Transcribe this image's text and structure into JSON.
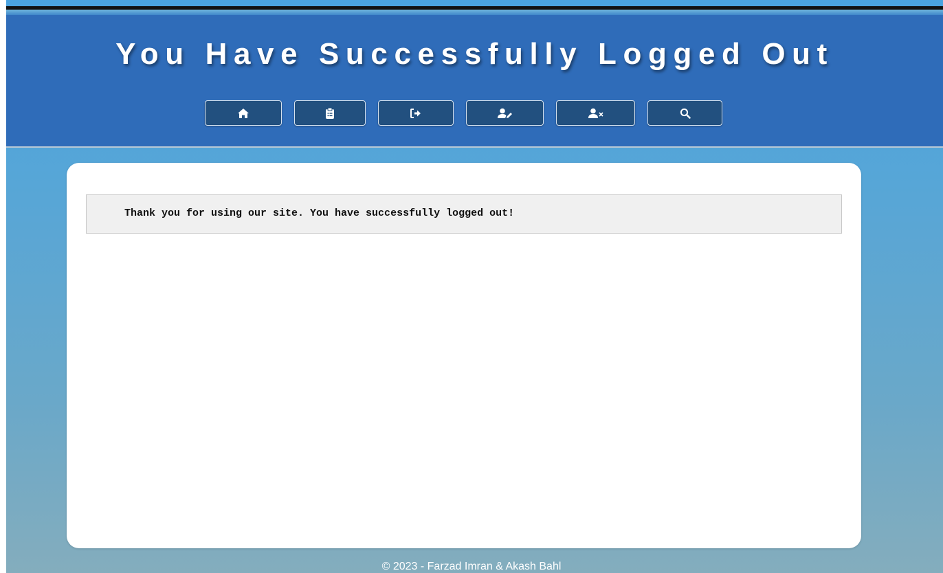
{
  "header": {
    "title": "You Have Successfully Logged Out",
    "nav": [
      {
        "icon": "home-icon",
        "label": ""
      },
      {
        "icon": "clipboard-list-icon",
        "label": ""
      },
      {
        "icon": "sign-in-icon",
        "label": ""
      },
      {
        "icon": "user-edit-icon",
        "label": ""
      },
      {
        "icon": "user-remove-icon",
        "label": ""
      },
      {
        "icon": "search-icon",
        "label": ""
      }
    ]
  },
  "main": {
    "message": "Thank you for using our site. You have successfully logged out!"
  },
  "footer": {
    "copyright": "© 2023 - Farzad Imran & Akash Bahl"
  },
  "colors": {
    "header_bg": "#2f6cb9",
    "nav_button_bg": "#22507f",
    "message_bg": "#f0f0f0"
  }
}
